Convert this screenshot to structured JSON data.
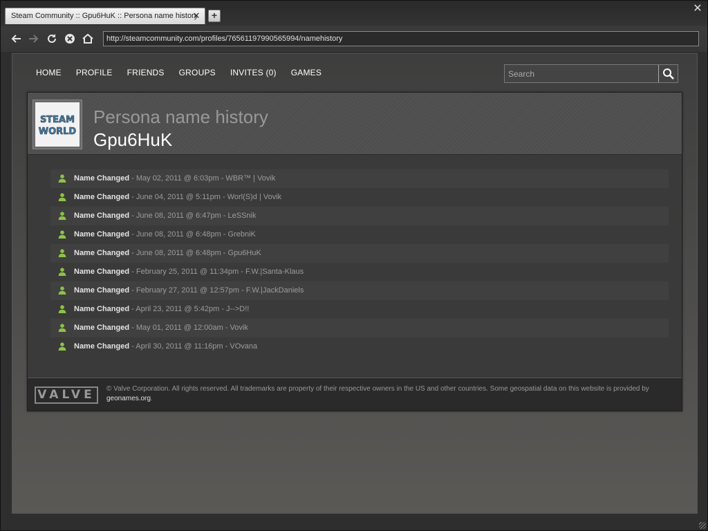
{
  "browser": {
    "tab_title": "Steam Community :: Gpu6HuK :: Persona name history",
    "tab_close": "✕",
    "new_tab": "+",
    "window_close": "✕",
    "url": "http://steamcommunity.com/profiles/76561197990565994/namehistory"
  },
  "nav": {
    "items": [
      "HOME",
      "PROFILE",
      "FRIENDS",
      "GROUPS",
      "INVITES (0)",
      "GAMES"
    ],
    "search_placeholder": "Search"
  },
  "profile": {
    "avatar_text": "STEAM WORLD",
    "subtitle": "Persona name history",
    "name": "Gpu6HuK"
  },
  "history": [
    {
      "label": "Name Changed",
      "detail": " - May 02, 2011 @ 6:03pm - WBR™ | Vovik"
    },
    {
      "label": "Name Changed",
      "detail": " - June 04, 2011 @ 5:11pm - Worl(S)d | Vovik"
    },
    {
      "label": "Name Changed",
      "detail": " - June 08, 2011 @ 6:47pm - LeSSnik"
    },
    {
      "label": "Name Changed",
      "detail": " - June 08, 2011 @ 6:48pm - GrebniK"
    },
    {
      "label": "Name Changed",
      "detail": " - June 08, 2011 @ 6:48pm - Gpu6HuK"
    },
    {
      "label": "Name Changed",
      "detail": " - February 25, 2011 @ 11:34pm - F.W.|Santa-Klaus"
    },
    {
      "label": "Name Changed",
      "detail": " - February 27, 2011 @ 12:57pm - F.W.|JackDaniels"
    },
    {
      "label": "Name Changed",
      "detail": " - April 23, 2011 @ 5:42pm - J-->D!!"
    },
    {
      "label": "Name Changed",
      "detail": " - May 01, 2011 @ 12:00am - Vovik"
    },
    {
      "label": "Name Changed",
      "detail": " - April 30, 2011 @ 11:16pm - VOvana"
    }
  ],
  "footer": {
    "logo": "VALVE",
    "text": "© Valve Corporation. All rights reserved. All trademarks are property of their respective owners in the US and other countries. Some geospatial data on this website is provided by ",
    "link": "geonames.org",
    "text_end": "."
  },
  "colors": {
    "accent_green": "#8bc53f"
  }
}
